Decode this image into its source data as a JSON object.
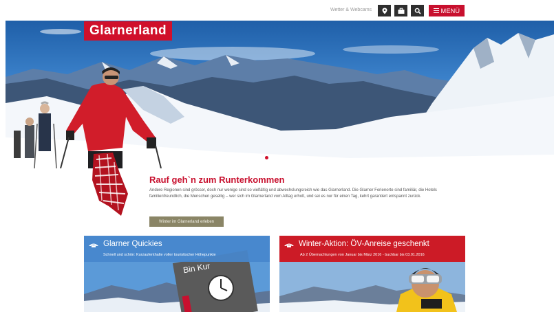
{
  "topbar": {
    "weather_link": "Wetter & Webcams",
    "icons": [
      "map-marker-icon",
      "briefcase-icon",
      "search-icon"
    ],
    "menu_label": "MENÜ"
  },
  "hero": {
    "logo": "Glarnerland",
    "slides_total": 4,
    "slide_active": 1
  },
  "intro": {
    "headline": "Rauf geh`n zum Runterkommen",
    "body": "Andere Regionen sind grösser, doch nur wenige sind so vielfältig und abwechslungsreich wie das Glarnerland. Die Glarner Ferienorte sind familiär, die Hotels familienfreundlich, die Menschen gesellig – wer sich im Glarnerland vom Alltag erholt, und sei es nur für einen Tag, kehrt garantiert entspannt zurück.",
    "cta_label": "Winter im Glarnerland erleben"
  },
  "cards": [
    {
      "title": "Glarner Quickies",
      "subtitle": "Schnell und schön: Kurzaufenthalte voller touristischer Höhepunkte",
      "sign_text": "Bin Kur"
    },
    {
      "title": "Winter-Aktion: ÖV-Anreise geschenkt",
      "subtitle": "Ab 2 Übernachtungen von Januar bis März 2016 - buchbar bis 03.01.2016"
    }
  ],
  "colors": {
    "brand_red": "#d0102b",
    "dark_button": "#2e2e2e",
    "cta_olive": "#8a8566",
    "card_blue": "#4e8fd3"
  }
}
